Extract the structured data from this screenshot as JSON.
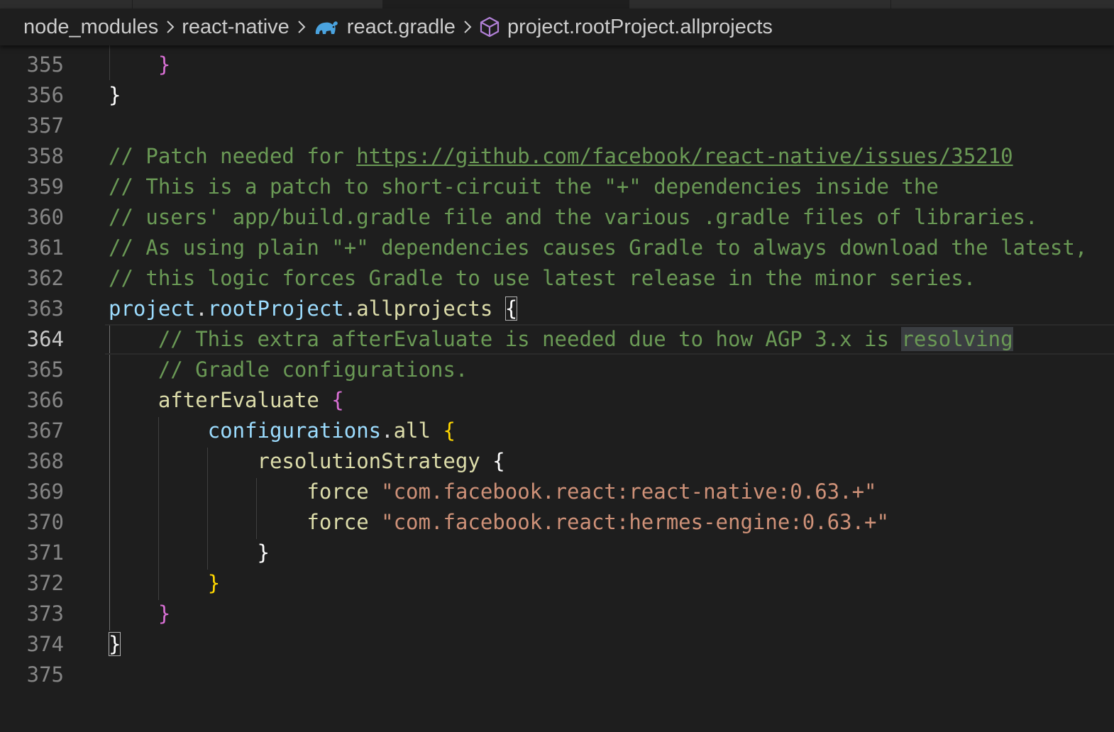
{
  "breadcrumb": {
    "items": [
      {
        "label": "node_modules"
      },
      {
        "label": "react-native"
      },
      {
        "label": "react.gradle",
        "icon": "gradle-elephant-icon"
      },
      {
        "label": "project.rootProject.allprojects",
        "icon": "symbol-namespace-icon"
      }
    ]
  },
  "editor": {
    "language": "gradle",
    "current_line": 364,
    "lines": [
      {
        "n": "355",
        "segments": [
          {
            "t": "    "
          },
          {
            "t": "}",
            "c": "t-b2"
          }
        ]
      },
      {
        "n": "356",
        "segments": [
          {
            "t": "}",
            "c": "t-bw"
          }
        ]
      },
      {
        "n": "357",
        "segments": []
      },
      {
        "n": "358",
        "segments": [
          {
            "t": "// Patch needed for ",
            "c": "t-com"
          },
          {
            "t": "https://github.com/facebook/react-native/issues/35210",
            "c": "t-link"
          }
        ]
      },
      {
        "n": "359",
        "segments": [
          {
            "t": "// This is a patch to short-circuit the \"+\" dependencies inside the",
            "c": "t-com"
          }
        ]
      },
      {
        "n": "360",
        "segments": [
          {
            "t": "// users' app/build.gradle file and the various .gradle files of libraries.",
            "c": "t-com"
          }
        ]
      },
      {
        "n": "361",
        "segments": [
          {
            "t": "// As using plain \"+\" dependencies causes Gradle to always download the latest,",
            "c": "t-com"
          }
        ]
      },
      {
        "n": "362",
        "segments": [
          {
            "t": "// this logic forces Gradle to use latest release in the minor series.",
            "c": "t-com"
          }
        ]
      },
      {
        "n": "363",
        "segments": [
          {
            "t": "project",
            "c": "t-prop"
          },
          {
            "t": ".",
            "c": "t-plain"
          },
          {
            "t": "rootProject",
            "c": "t-prop"
          },
          {
            "t": ".",
            "c": "t-plain"
          },
          {
            "t": "allprojects",
            "c": "t-fn"
          },
          {
            "t": " ",
            "c": "t-plain"
          },
          {
            "t": "{",
            "c": "t-bw match-box"
          }
        ]
      },
      {
        "n": "364",
        "segments": [
          {
            "t": "    "
          },
          {
            "t": "// This extra afterEvaluate is needed due to how AGP 3.x is ",
            "c": "t-com"
          },
          {
            "t": "resolving",
            "c": "t-com sel-hl"
          }
        ]
      },
      {
        "n": "365",
        "segments": [
          {
            "t": "    "
          },
          {
            "t": "// Gradle configurations.",
            "c": "t-com"
          }
        ]
      },
      {
        "n": "366",
        "segments": [
          {
            "t": "    "
          },
          {
            "t": "afterEvaluate",
            "c": "t-fn"
          },
          {
            "t": " ",
            "c": "t-plain"
          },
          {
            "t": "{",
            "c": "t-b2"
          }
        ]
      },
      {
        "n": "367",
        "segments": [
          {
            "t": "        "
          },
          {
            "t": "configurations",
            "c": "t-prop"
          },
          {
            "t": ".",
            "c": "t-plain"
          },
          {
            "t": "all",
            "c": "t-fn"
          },
          {
            "t": " ",
            "c": "t-plain"
          },
          {
            "t": "{",
            "c": "t-b1"
          }
        ]
      },
      {
        "n": "368",
        "segments": [
          {
            "t": "            "
          },
          {
            "t": "resolutionStrategy",
            "c": "t-fn"
          },
          {
            "t": " ",
            "c": "t-plain"
          },
          {
            "t": "{",
            "c": "t-bw"
          }
        ]
      },
      {
        "n": "369",
        "segments": [
          {
            "t": "                "
          },
          {
            "t": "force",
            "c": "t-fn"
          },
          {
            "t": " ",
            "c": "t-plain"
          },
          {
            "t": "\"com.facebook.react:react-native:0.63.+\"",
            "c": "t-str"
          }
        ]
      },
      {
        "n": "370",
        "segments": [
          {
            "t": "                "
          },
          {
            "t": "force",
            "c": "t-fn"
          },
          {
            "t": " ",
            "c": "t-plain"
          },
          {
            "t": "\"com.facebook.react:hermes-engine:0.63.+\"",
            "c": "t-str"
          }
        ]
      },
      {
        "n": "371",
        "segments": [
          {
            "t": "            "
          },
          {
            "t": "}",
            "c": "t-bw"
          }
        ]
      },
      {
        "n": "372",
        "segments": [
          {
            "t": "        "
          },
          {
            "t": "}",
            "c": "t-b1"
          }
        ]
      },
      {
        "n": "373",
        "segments": [
          {
            "t": "    "
          },
          {
            "t": "}",
            "c": "t-b2"
          }
        ]
      },
      {
        "n": "374",
        "segments": [
          {
            "t": "}",
            "c": "t-bw match-box"
          }
        ]
      },
      {
        "n": "375",
        "segments": []
      }
    ]
  }
}
